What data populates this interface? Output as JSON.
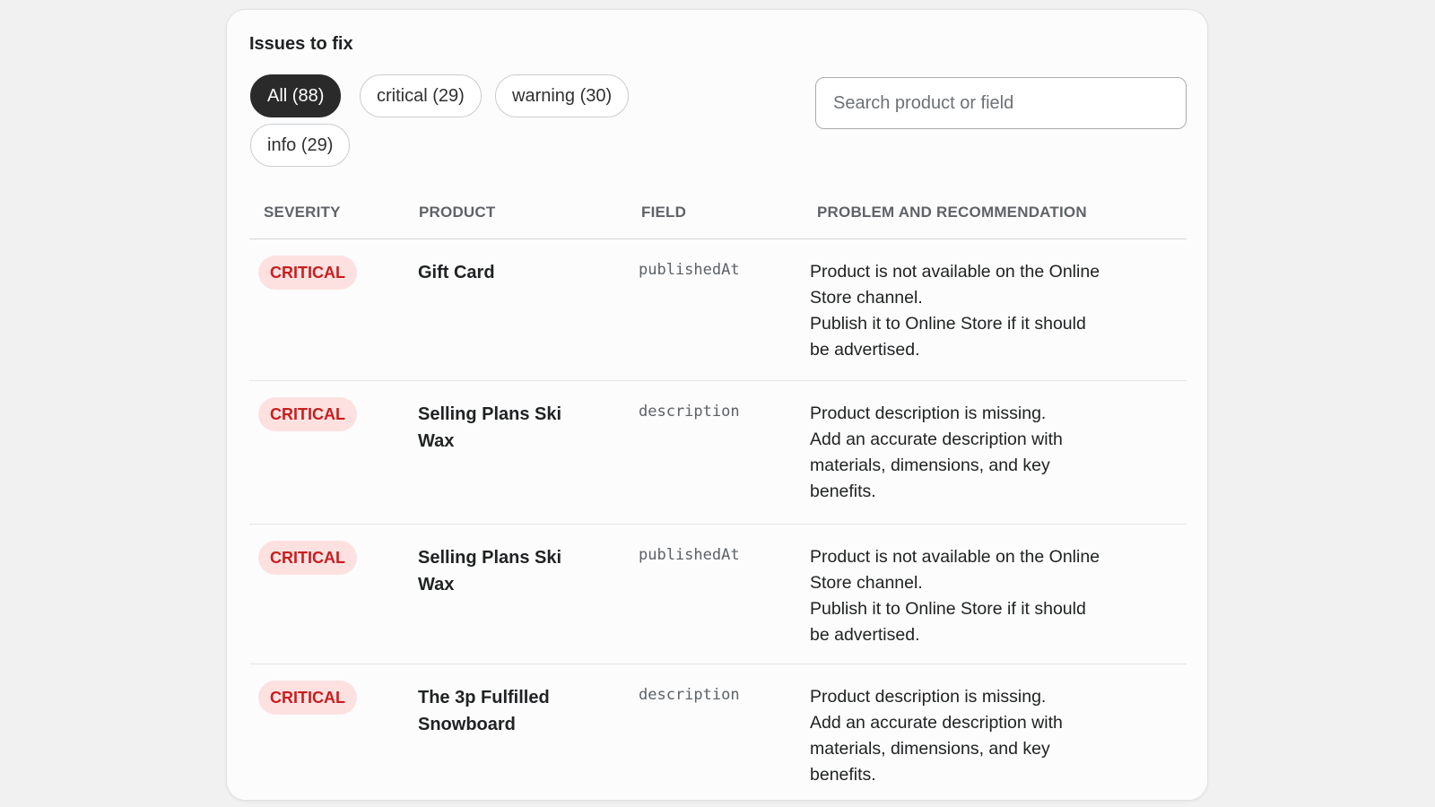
{
  "card": {
    "title": "Issues to fix"
  },
  "filters": [
    {
      "label": "All (88)",
      "active": true
    },
    {
      "label": "critical (29)",
      "active": false
    },
    {
      "label": "warning (30)",
      "active": false
    },
    {
      "label": "info (29)",
      "active": false
    }
  ],
  "search": {
    "placeholder": "Search product or field",
    "value": ""
  },
  "table": {
    "headers": {
      "severity": "SEVERITY",
      "product": "PRODUCT",
      "field": "FIELD",
      "problem": "PROBLEM AND RECOMMENDATION"
    },
    "rows": [
      {
        "severity": "CRITICAL",
        "product": "Gift Card",
        "field": "publishedAt",
        "problem": "Product is not available on the Online Store channel.",
        "recommendation": "Publish it to Online Store if it should be advertised."
      },
      {
        "severity": "CRITICAL",
        "product": "Selling Plans Ski Wax",
        "field": "description",
        "problem": "Product description is missing.",
        "recommendation": "Add an accurate description with materials, dimensions, and key benefits."
      },
      {
        "severity": "CRITICAL",
        "product": "Selling Plans Ski Wax",
        "field": "publishedAt",
        "problem": "Product is not available on the Online Store channel.",
        "recommendation": "Publish it to Online Store if it should be advertised."
      },
      {
        "severity": "CRITICAL",
        "product": "The 3p Fulfilled Snowboard",
        "field": "description",
        "problem": "Product description is missing.",
        "recommendation": "Add an accurate description with materials, dimensions, and key benefits."
      }
    ]
  },
  "colors": {
    "critical_text": "#c81e1e",
    "critical_bg": "#fde1e1",
    "active_pill": "#2a2a2a"
  }
}
